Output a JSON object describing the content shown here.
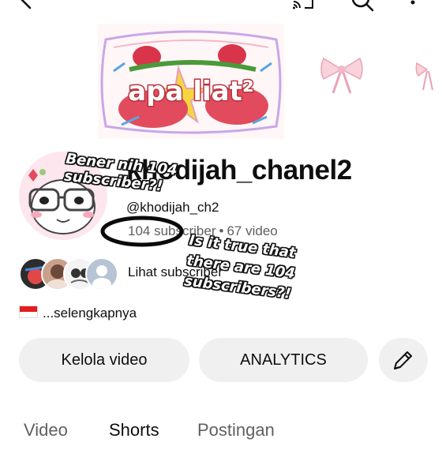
{
  "topbar": {
    "icons": [
      "back-icon",
      "cast-icon",
      "search-icon",
      "more-icon"
    ]
  },
  "banner": {
    "text": "apa liat²"
  },
  "channel": {
    "name": "khodijah_chanel2",
    "handle": "@khodijah_ch2",
    "subscribers": "104 subscriber",
    "separator": "•",
    "videos": "67 video",
    "subscribers_link": "Lihat subscriber",
    "description": "...selengkapnya"
  },
  "actions": {
    "manage": "Kelola video",
    "analytics": "ANALYTICS"
  },
  "tabs": [
    "Video",
    "Shorts",
    "Postingan"
  ],
  "stickers": {
    "top_line1": "Bener nih 104",
    "top_line2": "subscriber?!",
    "bottom_line1": "Is it true that",
    "bottom_line2": "there are 104",
    "bottom_line3": "subscribers?!"
  },
  "colors": {
    "accent_pink": "#f2b8c6",
    "banner_red": "#d8354a",
    "flag_red": "#e31d1c"
  }
}
